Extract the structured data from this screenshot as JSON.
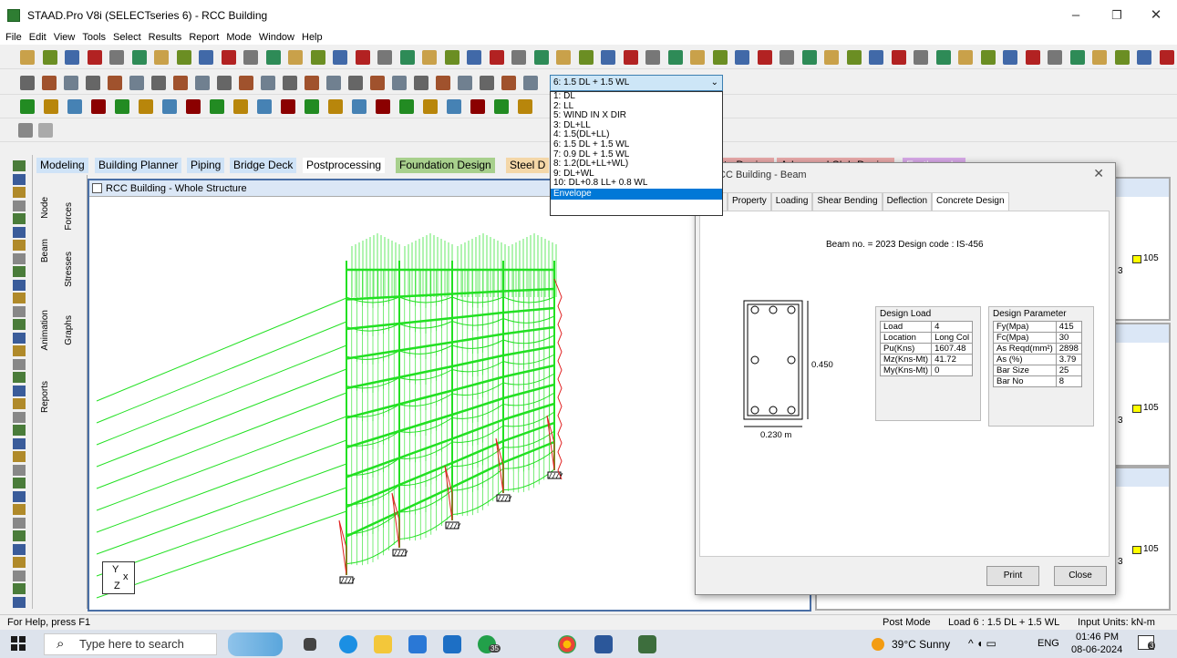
{
  "title_bar": {
    "title": "STAAD.Pro V8i (SELECTseries 6) - RCC Building",
    "min": "–",
    "max": "❐",
    "close": "✕"
  },
  "menu": [
    "File",
    "Edit",
    "View",
    "Tools",
    "Select",
    "Results",
    "Report",
    "Mode",
    "Window",
    "Help"
  ],
  "load_selector": {
    "value": "6: 1.5 DL + 1.5 WL",
    "options": [
      "1: DL",
      "2: LL",
      "5: WIND IN X DIR",
      "3: DL+LL",
      "4: 1.5(DL+LL)",
      "6: 1.5 DL + 1.5 WL",
      "7: 0.9 DL + 1.5 WL",
      "8: 1.2(DL+LL+WL)",
      "9: DL+WL",
      "10: DL+0.8 LL+ 0.8 WL",
      "Envelope"
    ],
    "highlighted": "Envelope"
  },
  "page_tabs": [
    "Modeling",
    "Building Planner",
    "Piping",
    "Bridge Deck",
    "Postprocessing",
    "Foundation Design",
    "Steel D",
    "te Design",
    "Advanced Slab Design",
    "Earthquake"
  ],
  "side_tabs": {
    "node": "Node",
    "beam": "Beam",
    "animation": "Animation",
    "reports": "Reports",
    "forces": "Forces",
    "stresses": "Stresses",
    "graphs": "Graphs"
  },
  "main_window": {
    "title": "RCC Building - Whole Structure",
    "axis_y": "Y",
    "axis_x": "x",
    "axis_z": "Z"
  },
  "dialog": {
    "title": "CC Building - Beam",
    "close": "✕",
    "tabs": [
      "metry",
      "Property",
      "Loading",
      "Shear Bending",
      "Deflection",
      "Concrete Design"
    ],
    "active_tab": "Concrete Design",
    "beam_info": "Beam no. = 2023  Design code :  IS-456",
    "section": {
      "depth": "0.450",
      "width": "0.230 m"
    },
    "design_load": {
      "title": "Design Load",
      "rows": [
        [
          "Load",
          "4"
        ],
        [
          "Location",
          "Long Col"
        ],
        [
          "Pu(Kns)",
          "1607.48"
        ],
        [
          "Mz(Kns-Mt)",
          "41.72"
        ],
        [
          "My(Kns-Mt)",
          "0"
        ]
      ]
    },
    "design_parameter": {
      "title": "Design Parameter",
      "rows": [
        [
          "Fy(Mpa)",
          "415"
        ],
        [
          "Fc(Mpa)",
          "30"
        ],
        [
          "As Reqd(mm²)",
          "2898"
        ],
        [
          "As (%)",
          "3.79"
        ],
        [
          "Bar Size",
          "25"
        ],
        [
          "Bar No",
          "8"
        ]
      ]
    },
    "print_label": "Print",
    "close_label": "Close"
  },
  "right_panels": [
    {
      "node": "105",
      "sub": "3"
    },
    {
      "node": "105",
      "sub": "3"
    },
    {
      "node": "105",
      "sub": "3"
    }
  ],
  "status": {
    "help": "For Help, press F1",
    "mode": "Post Mode",
    "load": "Load 6 : 1.5 DL + 1.5 WL",
    "units": "Input Units:  kN-m"
  },
  "taskbar": {
    "search_placeholder": "Type here to search",
    "weather": "39°C  Sunny",
    "lang": "ENG",
    "time": "01:46 PM",
    "date": "08-06-2024",
    "badge": "35",
    "notif": "3"
  },
  "colors": {
    "model_green": "#22e022",
    "moment_red": "#e02020",
    "accent": "#0078d7"
  }
}
